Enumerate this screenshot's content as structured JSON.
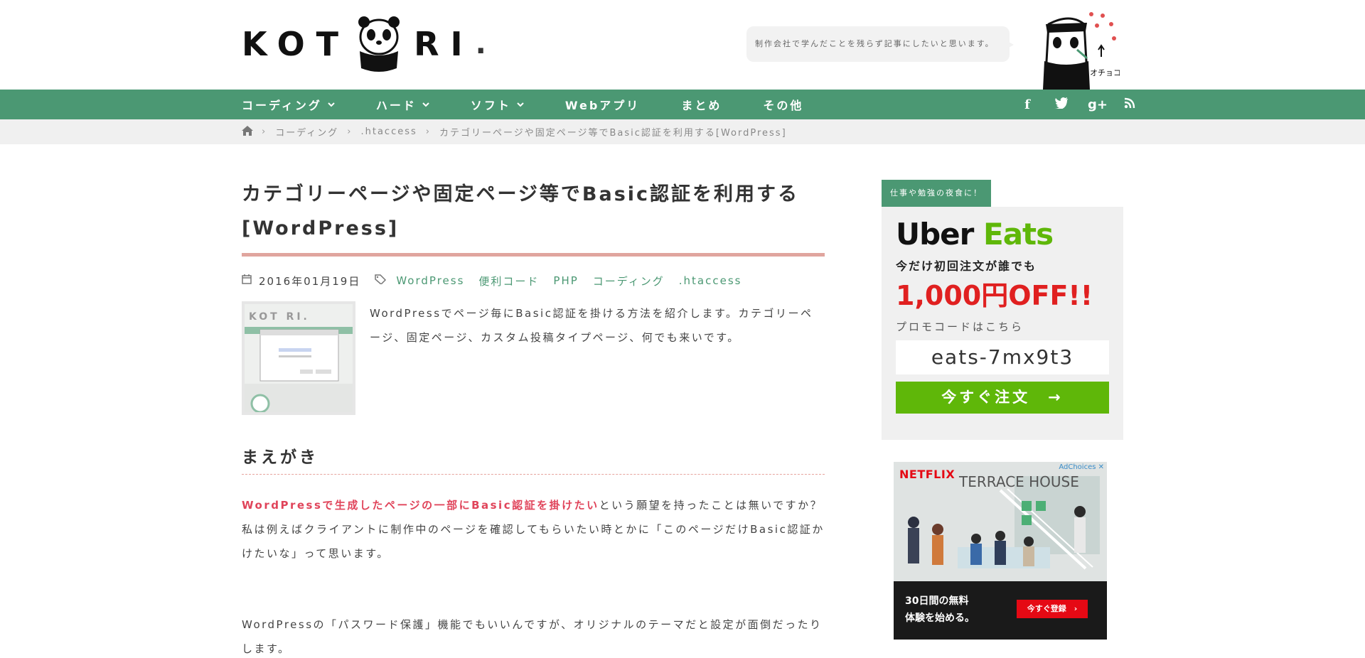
{
  "header": {
    "logo_left": "KOT",
    "logo_right": "RI",
    "logo_dot": ".",
    "tagline": "制作会社で学んだことを残らず記事にしたいと思います。",
    "mascot_caption": "オチョコ"
  },
  "nav": {
    "items": [
      {
        "label": "コーディング",
        "has_dropdown": true
      },
      {
        "label": "ハード",
        "has_dropdown": true
      },
      {
        "label": "ソフト",
        "has_dropdown": true
      },
      {
        "label": "Webアプリ",
        "has_dropdown": false
      },
      {
        "label": "まとめ",
        "has_dropdown": false
      },
      {
        "label": "その他",
        "has_dropdown": false
      }
    ],
    "chevron": "⌄",
    "social": [
      "facebook-icon",
      "twitter-icon",
      "google-plus-icon",
      "rss-icon"
    ],
    "social_glyphs": [
      "f",
      "🐦",
      "g+",
      "◠"
    ]
  },
  "breadcrumb": {
    "home_icon": "home-icon",
    "items": [
      "コーディング",
      ".htaccess",
      "カテゴリーページや固定ページ等でBasic認証を利用する[WordPress]"
    ],
    "separator": "›"
  },
  "article": {
    "title_line1": "カテゴリーページや固定ページ等でBasic認証を利用する",
    "title_line2": "[WordPress]",
    "date": "2016年01月19日",
    "tags": [
      "WordPress",
      "便利コード",
      "PHP",
      "コーディング",
      ".htaccess"
    ],
    "intro": "WordPressでページ毎にBasic認証を掛ける方法を紹介します。カテゴリーページ、固定ページ、カスタム投稿タイプページ、何でも来いです。",
    "section_heading": "まえがき",
    "highlight": "WordPressで生成したページの一部にBasic認証を掛けたい",
    "p1_rest": "という願望を持ったことは無いですか？",
    "p1_line2": "私は例えばクライアントに制作中のページを確認してもらいたい時とかに「このページだけBasic認証かけたいな」って思います。",
    "p2": "WordPressの「パスワード保護」機能でもいいんですが、オリジナルのテーマだと設定が面倒だったりします。"
  },
  "sidebar": {
    "label": "仕事や勉強の夜食に！",
    "uber_brand": "Uber",
    "eats_brand": "Eats",
    "promo_line": "今だけ初回注文が誰でも",
    "promo_off": "1,000円OFF!!",
    "code_label": "プロモコードはこちら",
    "code": "eats-7mx9t3",
    "order_button": "今すぐ注文　→"
  },
  "ad": {
    "brand": "NETFLIX",
    "choices": "AdChoices ✕",
    "show": "TERRACE HOUSE",
    "text_line1": "30日間の無料",
    "text_line2": "体験を始める。",
    "button": "今すぐ登録　›"
  },
  "colors": {
    "nav_green": "#4b9873",
    "accent_red": "#e0445a",
    "title_bar": "#e0a59e",
    "uber_green": "#5fb709"
  }
}
